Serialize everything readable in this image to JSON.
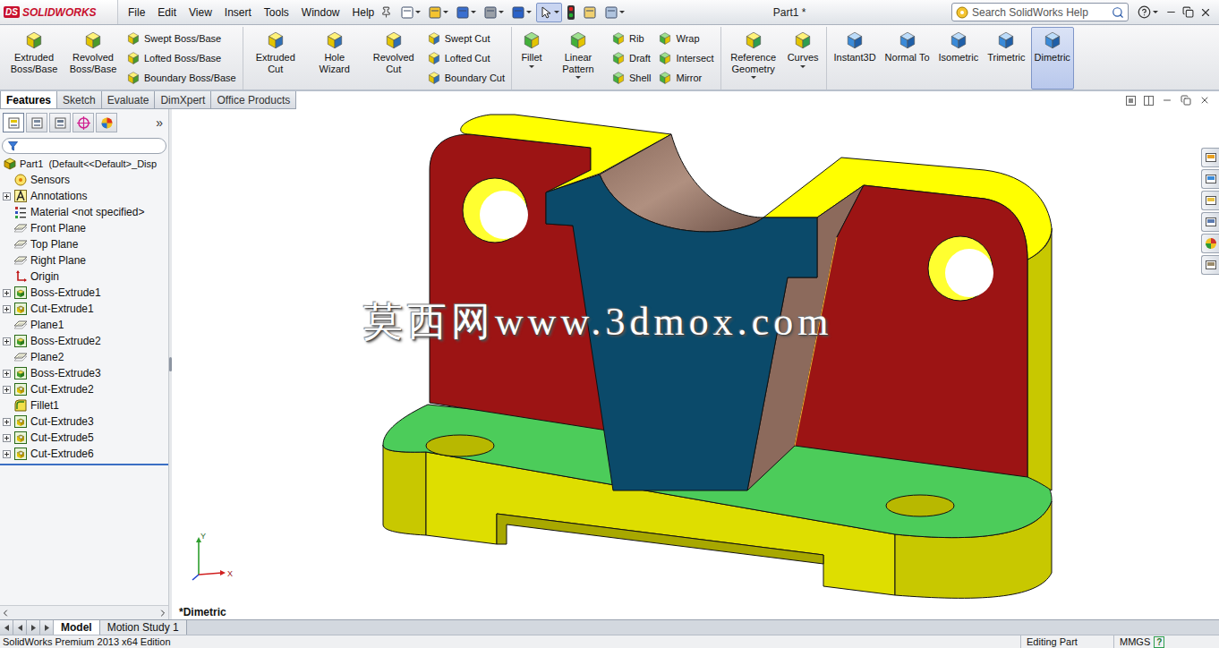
{
  "app": {
    "logo_mark": "DS",
    "logo_name": "SOLIDWORKS",
    "title": "Part1 *"
  },
  "menu": [
    {
      "label": "File"
    },
    {
      "label": "Edit"
    },
    {
      "label": "View"
    },
    {
      "label": "Insert"
    },
    {
      "label": "Tools"
    },
    {
      "label": "Window"
    },
    {
      "label": "Help"
    }
  ],
  "quick_toolbar": [
    {
      "selected": false,
      "dropdown": true
    },
    {
      "selected": false,
      "dropdown": true
    },
    {
      "selected": false,
      "dropdown": true
    },
    {
      "selected": false,
      "dropdown": true
    },
    {
      "selected": false,
      "dropdown": true
    },
    {
      "selected": true,
      "dropdown": true
    },
    {
      "selected": false,
      "dropdown": false
    },
    {
      "selected": false,
      "dropdown": false
    },
    {
      "selected": false,
      "dropdown": true
    }
  ],
  "search": {
    "placeholder": "Search SolidWorks Help"
  },
  "ribbon": {
    "groups": [
      {
        "kind": "boss",
        "columns": [
          {
            "kind": "large",
            "label": "Extruded Boss/Base",
            "selected": false,
            "dropdown": false
          },
          {
            "kind": "large",
            "label": "Revolved Boss/Base",
            "selected": false,
            "dropdown": false
          },
          {
            "kind": "stack",
            "items": [
              "Swept Boss/Base",
              "Lofted Boss/Base",
              "Boundary Boss/Base"
            ]
          }
        ]
      },
      {
        "kind": "cut",
        "columns": [
          {
            "kind": "large",
            "label": "Extruded Cut",
            "selected": false,
            "dropdown": false
          },
          {
            "kind": "large",
            "label": "Hole Wizard",
            "selected": false,
            "dropdown": false
          },
          {
            "kind": "large",
            "label": "Revolved Cut",
            "selected": false,
            "dropdown": false
          },
          {
            "kind": "stack",
            "items": [
              "Swept Cut",
              "Lofted Cut",
              "Boundary Cut"
            ]
          }
        ]
      },
      {
        "kind": "feature",
        "columns": [
          {
            "kind": "large",
            "label": "Fillet",
            "selected": false,
            "dropdown": true
          },
          {
            "kind": "large",
            "label": "Linear Pattern",
            "selected": false,
            "dropdown": true
          },
          {
            "kind": "stack",
            "items": [
              "Rib",
              "Draft",
              "Shell"
            ]
          },
          {
            "kind": "stack",
            "items": [
              "Wrap",
              "Intersect",
              "Mirror"
            ]
          }
        ]
      },
      {
        "kind": "ref",
        "columns": [
          {
            "kind": "large",
            "label": "Reference Geometry",
            "selected": false,
            "dropdown": true
          },
          {
            "kind": "large",
            "label": "Curves",
            "selected": false,
            "dropdown": true
          }
        ]
      },
      {
        "kind": "view",
        "columns": [
          {
            "kind": "large",
            "label": "Instant3D",
            "selected": false,
            "dropdown": false
          },
          {
            "kind": "large",
            "label": "Normal To",
            "selected": false,
            "dropdown": false
          },
          {
            "kind": "large",
            "label": "Isometric",
            "selected": false,
            "dropdown": false
          },
          {
            "kind": "large",
            "label": "Trimetric",
            "selected": false,
            "dropdown": false
          },
          {
            "kind": "large",
            "label": "Dimetric",
            "selected": true,
            "dropdown": false
          }
        ]
      }
    ]
  },
  "command_tabs": [
    {
      "label": "Features",
      "selected": true
    },
    {
      "label": "Sketch",
      "selected": false
    },
    {
      "label": "Evaluate",
      "selected": false
    },
    {
      "label": "DimXpert",
      "selected": false
    },
    {
      "label": "Office Products",
      "selected": false
    }
  ],
  "feature_panel": {
    "tabs": [
      {
        "selected": true
      },
      {
        "selected": false
      },
      {
        "selected": false
      },
      {
        "selected": false
      },
      {
        "selected": false
      }
    ],
    "more": "»"
  },
  "tree": [
    {
      "label": "Part1  (Default<<Default>_Disp",
      "kind": "part",
      "has_children": false
    },
    {
      "label": "Sensors",
      "kind": "sensor",
      "has_children": false
    },
    {
      "label": "Annotations",
      "kind": "annotation",
      "has_children": true
    },
    {
      "label": "Material <not specified>",
      "kind": "material",
      "has_children": false
    },
    {
      "label": "Front Plane",
      "kind": "plane",
      "has_children": false
    },
    {
      "label": "Top Plane",
      "kind": "plane",
      "has_children": false
    },
    {
      "label": "Right Plane",
      "kind": "plane",
      "has_children": false
    },
    {
      "label": "Origin",
      "kind": "origin",
      "has_children": false
    },
    {
      "label": "Boss-Extrude1",
      "kind": "extrude",
      "has_children": true
    },
    {
      "label": "Cut-Extrude1",
      "kind": "cut",
      "has_children": true
    },
    {
      "label": "Plane1",
      "kind": "plane",
      "has_children": false
    },
    {
      "label": "Boss-Extrude2",
      "kind": "extrude",
      "has_children": true
    },
    {
      "label": "Plane2",
      "kind": "plane",
      "has_children": false
    },
    {
      "label": "Boss-Extrude3",
      "kind": "extrude",
      "has_children": true
    },
    {
      "label": "Cut-Extrude2",
      "kind": "cut",
      "has_children": true
    },
    {
      "label": "Fillet1",
      "kind": "fillet",
      "has_children": false
    },
    {
      "label": "Cut-Extrude3",
      "kind": "cut",
      "has_children": true
    },
    {
      "label": "Cut-Extrude5",
      "kind": "cut",
      "has_children": true
    },
    {
      "label": "Cut-Extrude6",
      "kind": "cut",
      "has_children": true
    }
  ],
  "viewport": {
    "view_label": "*Dimetric",
    "watermark": "莫西网www.3dmox.com",
    "axes": {
      "y": "Y",
      "x": "X"
    }
  },
  "bottom_tabs": [
    {
      "label": "Model",
      "selected": true
    },
    {
      "label": "Motion Study 1",
      "selected": false
    }
  ],
  "status_bar": {
    "edition": "SolidWorks Premium 2013 x64 Edition",
    "mode": "Editing Part",
    "units": "MMGS",
    "help": "?"
  }
}
